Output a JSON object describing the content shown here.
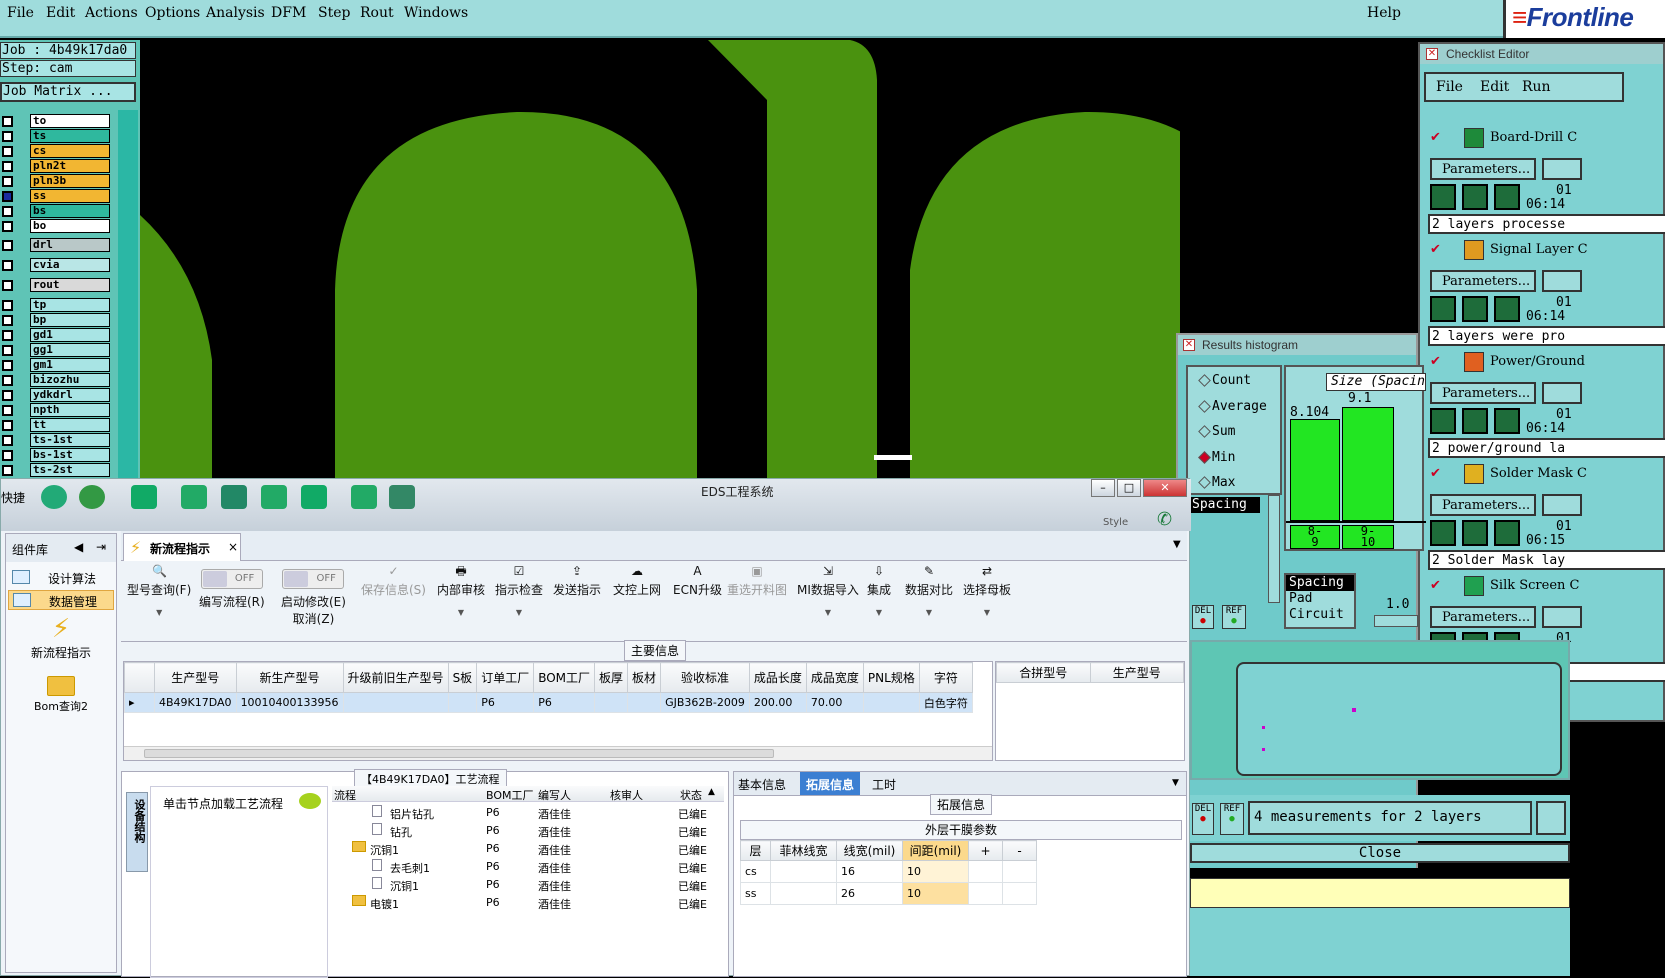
{
  "menubar": {
    "items": [
      "File",
      "Edit",
      "Actions",
      "Options",
      "Analysis",
      "DFM",
      "Step",
      "Rout",
      "Windows"
    ],
    "help": "Help",
    "logo": "Frontline"
  },
  "job_panel": {
    "job_line": "Job : 4b49k17da0",
    "step_line": "Step: cam",
    "matrix_button": "Job Matrix ...",
    "layers": [
      {
        "name": "to",
        "color": "#ffffff",
        "checked": false
      },
      {
        "name": "ts",
        "color": "#2fb89e",
        "checked": false
      },
      {
        "name": "cs",
        "color": "#f2b632",
        "checked": false
      },
      {
        "name": "pln2t",
        "color": "#f2b632",
        "checked": false
      },
      {
        "name": "pln3b",
        "color": "#f2b632",
        "checked": false
      },
      {
        "name": "ss",
        "color": "#f2b632",
        "checked": true
      },
      {
        "name": "bs",
        "color": "#2fb89e",
        "checked": false
      },
      {
        "name": "bo",
        "color": "#ffffff",
        "checked": false
      },
      {
        "name": "drl",
        "color": "#b9c8c8",
        "checked": false
      },
      {
        "name": "cvia",
        "color": "#b9e6e6",
        "checked": false
      },
      {
        "name": "rout",
        "color": "#d9d9d9",
        "checked": false
      },
      {
        "name": "tp",
        "color": "#a8e4e4",
        "checked": false
      },
      {
        "name": "bp",
        "color": "#a8e4e4",
        "checked": false
      },
      {
        "name": "gd1",
        "color": "#a8e4e4",
        "checked": false
      },
      {
        "name": "gg1",
        "color": "#a8e4e4",
        "checked": false
      },
      {
        "name": "gm1",
        "color": "#a8e4e4",
        "checked": false
      },
      {
        "name": "bizozhu",
        "color": "#a8e4e4",
        "checked": false
      },
      {
        "name": "ydkdrl",
        "color": "#a8e4e4",
        "checked": false
      },
      {
        "name": "npth",
        "color": "#a8e4e4",
        "checked": false
      },
      {
        "name": "tt",
        "color": "#a8e4e4",
        "checked": false
      },
      {
        "name": "ts-1st",
        "color": "#a8e4e4",
        "checked": false
      },
      {
        "name": "bs-1st",
        "color": "#a8e4e4",
        "checked": false
      },
      {
        "name": "ts-2st",
        "color": "#a8e4e4",
        "checked": false
      }
    ]
  },
  "checklist": {
    "title": "Checklist Editor",
    "menu": [
      "File",
      "Edit",
      "Run"
    ],
    "params_label": "Parameters...",
    "items": [
      {
        "name": "Board-Drill C",
        "date": "01",
        "time": "06:14",
        "msg": "2 layers processe"
      },
      {
        "name": "Signal Layer C",
        "date": "01",
        "time": "06:14",
        "msg": "2 layers were pro"
      },
      {
        "name": "Power/Ground",
        "date": "01",
        "time": "06:14",
        "msg": "2 power/ground la"
      },
      {
        "name": "Solder Mask C",
        "date": "01",
        "time": "06:15",
        "msg": "2 Solder Mask lay"
      },
      {
        "name": "Silk Screen C",
        "date": "01",
        "time": "06:15",
        "msg": "2 Silk Screen lay"
      }
    ]
  },
  "histogram": {
    "title": "Results histogram",
    "modes": [
      "Count",
      "Average",
      "Sum",
      "Min",
      "Max"
    ],
    "selected_mode": "Min",
    "size_label": "Size (Spacin",
    "list_items": [
      "Spacing"
    ],
    "bars": [
      {
        "value": "8.104",
        "label": "8-9"
      },
      {
        "value": "9.1",
        "label": "9-10"
      }
    ],
    "bar_labels_lines": [
      [
        "8-",
        "9"
      ],
      [
        "9-",
        "10"
      ]
    ],
    "category_list": [
      "Spacing",
      "Pad",
      "Circuit"
    ],
    "slider_value": "1.0",
    "del_label": "DEL",
    "ref_label": "REF",
    "measurements": "4 measurements for 2 layers",
    "close": "Close"
  },
  "eds": {
    "title": "EDS工程系统",
    "toolbar_left_label": "快捷",
    "style_label": "Style",
    "sidebar": {
      "header": "组件库",
      "items": [
        "设计算法",
        "数据管理"
      ],
      "selected": "数据管理",
      "big_items": [
        "新流程指示",
        "Bom查询2"
      ]
    },
    "tab": {
      "label": "新流程指示",
      "close": "×"
    },
    "ribbon": [
      {
        "label": "型号查询(F)",
        "dropdown": true
      },
      {
        "label": "编写流程(R)",
        "toggle": "OFF"
      },
      {
        "label": "启动修改(E)",
        "sub": "取消(Z)",
        "toggle": "OFF"
      },
      {
        "label": "保存信息(S)",
        "disabled": true
      },
      {
        "label": "内部审核",
        "dropdown": true
      },
      {
        "label": "指示检查",
        "dropdown": true
      },
      {
        "label": "发送指示"
      },
      {
        "label": "文控上网"
      },
      {
        "label": "ECN升级"
      },
      {
        "label": "重选开料图",
        "disabled": true
      },
      {
        "label": "MI数据导入",
        "dropdown": true
      },
      {
        "label": "集成",
        "dropdown": true
      },
      {
        "label": "数据对比",
        "dropdown": true
      },
      {
        "label": "选择母板",
        "dropdown": true
      }
    ],
    "main_info_title": "主要信息",
    "main_table": {
      "columns": [
        "生产型号",
        "新生产型号",
        "升级前旧生产型号",
        "S板",
        "订单工厂",
        "BOM工厂",
        "板厚",
        "板材",
        "验收标准",
        "成品长度",
        "成品宽度",
        "PNL规格",
        "字符"
      ],
      "rows": [
        [
          "4B49K17DA0",
          "10010400133956",
          "",
          "",
          "P6",
          "P6",
          "",
          "",
          "GJB362B-2009",
          "200.00",
          "70.00",
          "",
          "白色字符"
        ]
      ]
    },
    "side_table": {
      "columns": [
        "合拼型号",
        "生产型号"
      ]
    },
    "flow_title": "【4B49K17DA0】工艺流程",
    "vertical_tab": "设备结构",
    "flow_hint": "单击节点加载工艺流程",
    "flow_table": {
      "columns": [
        "流程",
        "BOM工厂",
        "编写人",
        "核审人",
        "状态"
      ],
      "rows": [
        {
          "name": "铝片钻孔",
          "indent": 2,
          "folder": false,
          "factory": "P6",
          "writer": "酒佳佳",
          "status": "已编E"
        },
        {
          "name": "钻孔",
          "indent": 2,
          "folder": false,
          "factory": "P6",
          "writer": "酒佳佳",
          "status": "已编E"
        },
        {
          "name": "沉铜1",
          "indent": 1,
          "folder": true,
          "factory": "P6",
          "writer": "酒佳佳",
          "status": "已编E"
        },
        {
          "name": "去毛刺1",
          "indent": 2,
          "folder": false,
          "factory": "P6",
          "writer": "酒佳佳",
          "status": "已编E"
        },
        {
          "name": "沉铜1",
          "indent": 2,
          "folder": false,
          "factory": "P6",
          "writer": "酒佳佳",
          "status": "已编E"
        },
        {
          "name": "电镀1",
          "indent": 1,
          "folder": true,
          "factory": "P6",
          "writer": "酒佳佳",
          "status": "已编E"
        }
      ]
    },
    "info_tabs": [
      "基本信息",
      "拓展信息",
      "工时"
    ],
    "info_selected": "拓展信息",
    "ext_title": "拓展信息",
    "ext_table_title": "外层干膜参数",
    "ext_table": {
      "columns": [
        "层",
        "菲林线宽",
        "线宽(mil)",
        "间距(mil)",
        "+",
        "-"
      ],
      "rows": [
        [
          "cs",
          "",
          "16",
          "10"
        ],
        [
          "ss",
          "",
          "26",
          "10"
        ]
      ]
    }
  }
}
